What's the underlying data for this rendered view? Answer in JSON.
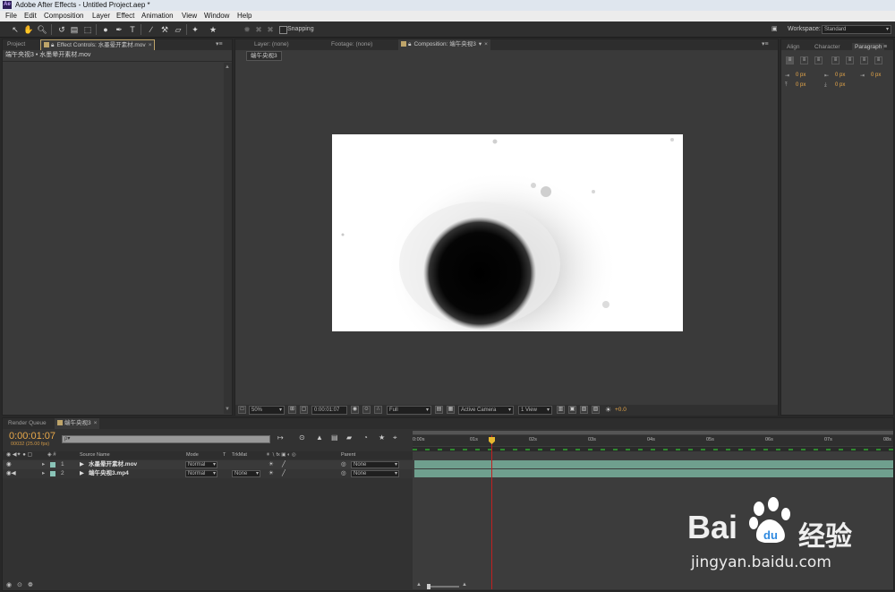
{
  "app": {
    "title": "Adobe After Effects - Untitled Project.aep *",
    "logo": "Ae"
  },
  "menu": [
    "File",
    "Edit",
    "Composition",
    "Layer",
    "Effect",
    "Animation",
    "View",
    "Window",
    "Help"
  ],
  "toolbar": {
    "snapping_label": "Snapping",
    "workspace_label": "Workspace:",
    "workspace_value": "Standard",
    "tool_icons": [
      "selection-tool-icon",
      "hand-tool-icon",
      "zoom-tool-icon",
      "rotation-tool-icon",
      "camera-tool-icon",
      "pan-behind-tool-icon",
      "mask-tool-icon",
      "pen-tool-icon",
      "type-tool-icon",
      "brush-tool-icon",
      "clone-stamp-tool-icon",
      "eraser-tool-icon",
      "roto-brush-tool-icon",
      "puppet-tool-icon"
    ]
  },
  "left_panel": {
    "tabs": [
      "Project",
      "Effect Controls: 水墨晕开素材.mov"
    ],
    "breadcrumb": "端午央视3 • 水墨晕开素材.mov"
  },
  "viewer": {
    "tabs": [
      "Layer: (none)",
      "Footage: (none)",
      "Composition: 端午央视3"
    ],
    "comp_tab_label": "端午央视3",
    "zoom": "50%",
    "timecode": "0:00:01:07",
    "resolution": "Full",
    "camera": "Active Camera",
    "views": "1 View",
    "exposure": "+0.0"
  },
  "right_panel": {
    "tabs": [
      "Align",
      "Character",
      "Paragraph"
    ],
    "indent_values": [
      "0 px",
      "0 px",
      "0 px",
      "0 px",
      "0 px"
    ]
  },
  "timeline": {
    "tabs": [
      "Render Queue",
      "端午央视3"
    ],
    "timecode": "0:00:01:07",
    "fps": "00032 (25.00 fps)",
    "search_placeholder": "ρ▾",
    "columns": [
      "Source Name",
      "Mode",
      "T",
      "TrkMat",
      "Parent"
    ],
    "layers": [
      {
        "num": "1",
        "name": "水墨晕开素材.mov",
        "mode": "Normal",
        "trkmat": "",
        "parent": "None"
      },
      {
        "num": "2",
        "name": "端午央视3.mp4",
        "mode": "Normal",
        "trkmat": "None",
        "parent": "None"
      }
    ],
    "ruler": [
      "0:00s",
      "01s",
      "02s",
      "03s",
      "04s",
      "05s",
      "06s",
      "07s",
      "08s"
    ],
    "playhead_fraction": 0.164
  },
  "watermark": {
    "brand": "Bai",
    "brand_cn": "经验",
    "url": "jingyan.baidu.com"
  },
  "colors": {
    "panel_bg": "#3a3a3a",
    "orange_timecode": "#e8a84a",
    "track_green": "#6f9f8e",
    "playhead_red": "#c02020"
  }
}
